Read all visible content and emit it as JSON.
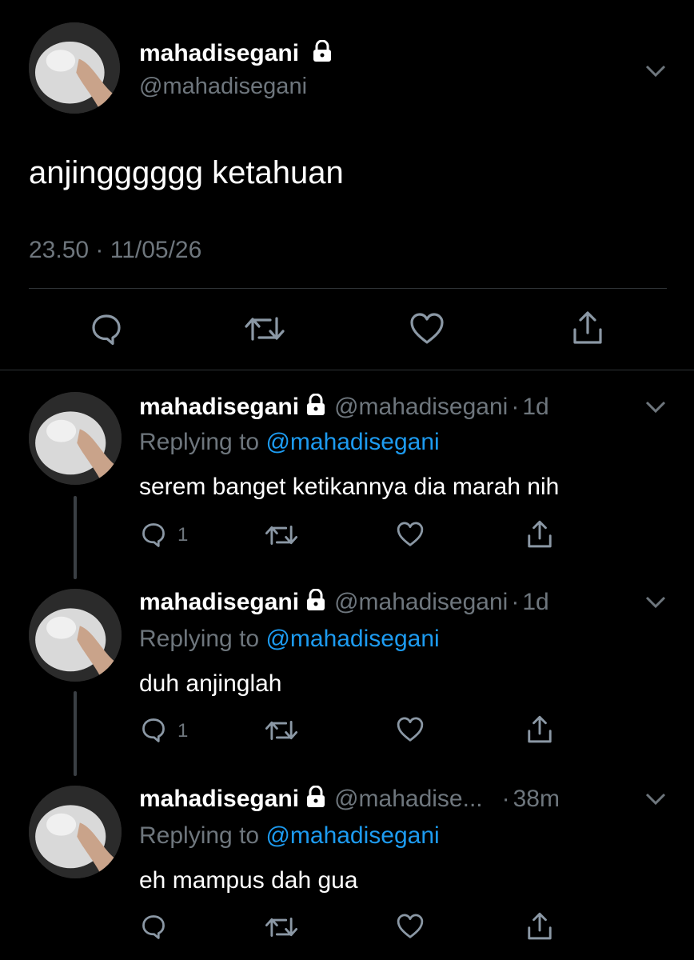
{
  "main_tweet": {
    "display_name": "mahadisegani",
    "handle": "@mahadisegani",
    "text": "anjingggggg ketahuan",
    "timestamp": "23.50 · 11/05/26"
  },
  "replies": [
    {
      "display_name": "mahadisegani",
      "handle": "@mahadisegani",
      "sep": "·",
      "time": "1d",
      "replying_prefix": "Replying to",
      "replying_to": "@mahadisegani",
      "text": "serem banget ketikannya dia marah nih",
      "reply_count": "1"
    },
    {
      "display_name": "mahadisegani",
      "handle": "@mahadisegani",
      "sep": "·",
      "time": "1d",
      "replying_prefix": "Replying to",
      "replying_to": "@mahadisegani",
      "text": "duh anjinglah",
      "reply_count": "1"
    },
    {
      "display_name": "mahadisegani",
      "handle": "@mahadise...",
      "sep": "·",
      "time": "38m",
      "replying_prefix": "Replying to",
      "replying_to": "@mahadisegani",
      "text": "eh mampus dah gua",
      "reply_count": ""
    }
  ],
  "icons": {
    "lock": "lock-icon",
    "caret": "chevron-down-icon",
    "reply": "reply-icon",
    "retweet": "retweet-icon",
    "like": "heart-icon",
    "share": "share-icon"
  },
  "colors": {
    "background": "#000000",
    "text": "#ffffff",
    "muted": "#6e767d",
    "link": "#1d9bf0",
    "divider": "#2f3336"
  }
}
